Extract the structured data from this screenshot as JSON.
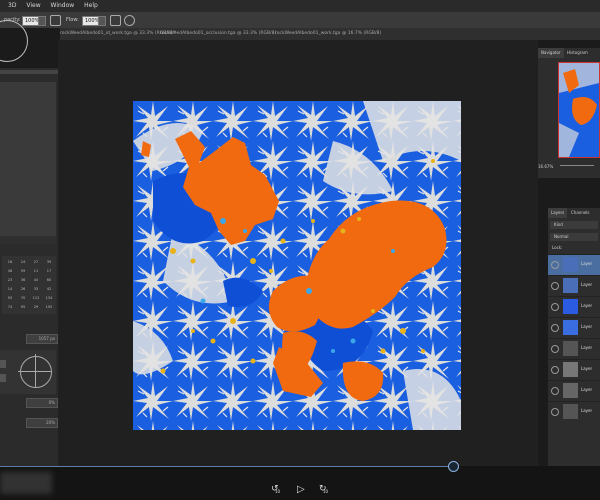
{
  "menu": [
    "3D",
    "View",
    "Window",
    "Help"
  ],
  "options": {
    "opacity_label": "pacity:",
    "opacity_value": "100%",
    "flow_label": "Flow:",
    "flow_value": "100%"
  },
  "tabs": [
    "rockWeedAlbedo01_id_work.tga @ 33.3% (RGB/8) *",
    "rockWeedAlbedo01_occlusion.tga @ 33.3% (RGB/8)",
    "rockWeedAlbedo01_work.tga @ 16.7% (RGB/8)"
  ],
  "left_panel": {
    "size_value": "1057 px",
    "field1": "0%",
    "field2": "20%",
    "brush_sizes": [
      "16",
      "24",
      "27",
      "39",
      "46",
      "59",
      "11",
      "17",
      "23",
      "36",
      "44",
      "60",
      "14",
      "26",
      "33",
      "42",
      "55",
      "70",
      "112",
      "134",
      "74",
      "95",
      "29",
      "192"
    ]
  },
  "navigator": {
    "tabs": [
      "Navigator",
      "Histogram"
    ],
    "zoom": "16.67%"
  },
  "layers": {
    "tabs": [
      "Layers",
      "Channels"
    ],
    "filter": "Kind",
    "blend_mode": "Normal",
    "lock_label": "Lock:",
    "items": [
      "Layer",
      "Layer",
      "Layer",
      "Layer",
      "Layer",
      "Layer",
      "Layer",
      "Layer"
    ]
  },
  "colors": {
    "accent_orange": "#f26a10",
    "texture_blue": "#1a5fe0",
    "timeline_blue": "#8ab4e0"
  },
  "player": {
    "rewind_icon": "rewind-10-icon",
    "play_icon": "play-icon",
    "forward_icon": "forward-10-icon",
    "rewind_label": "10",
    "forward_label": "10"
  }
}
